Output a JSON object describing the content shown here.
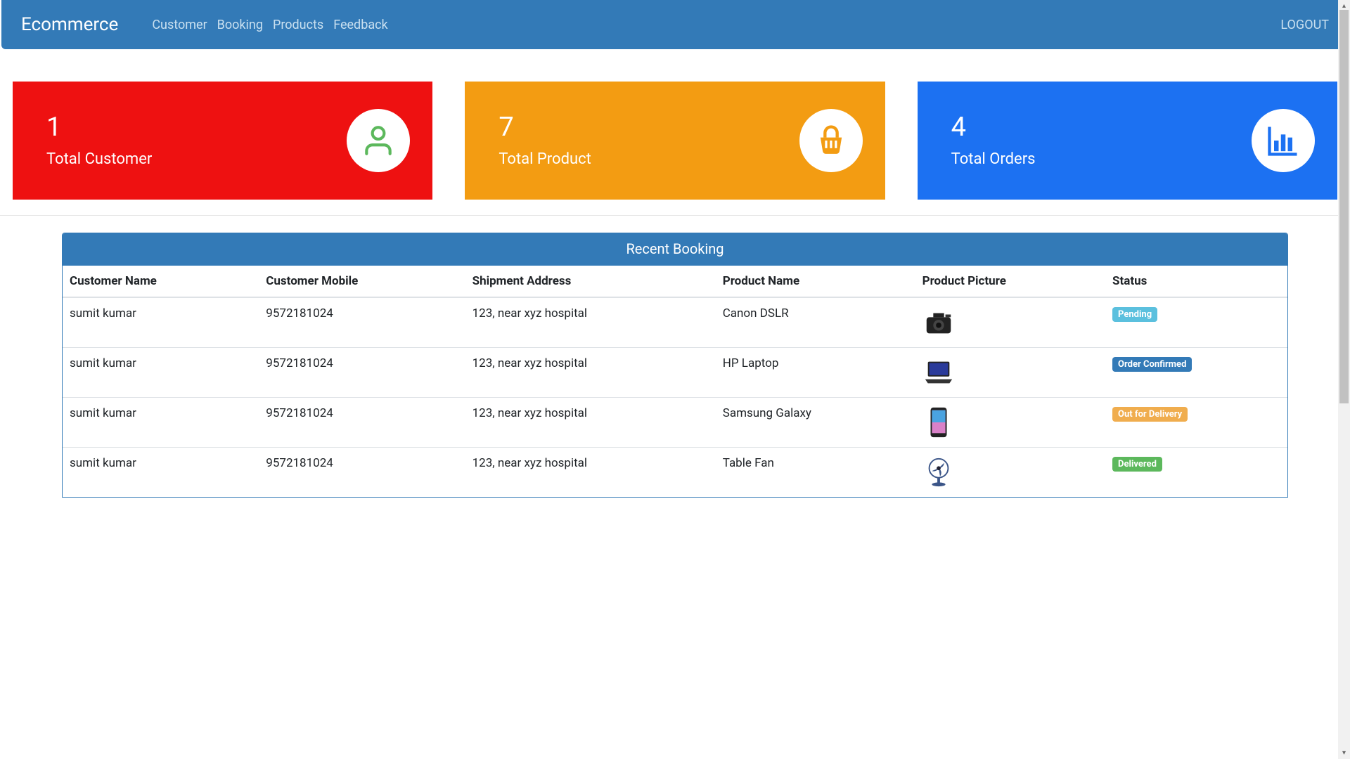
{
  "navbar": {
    "brand": "Ecommerce",
    "links": [
      "Customer",
      "Booking",
      "Products",
      "Feedback"
    ],
    "logout": "LOGOUT"
  },
  "stats": [
    {
      "value": "1",
      "label": "Total Customer",
      "color": "red",
      "icon": "user"
    },
    {
      "value": "7",
      "label": "Total Product",
      "color": "orange",
      "icon": "basket"
    },
    {
      "value": "4",
      "label": "Total Orders",
      "color": "blue",
      "icon": "chart"
    }
  ],
  "panel": {
    "title": "Recent Booking",
    "columns": [
      "Customer Name",
      "Customer Mobile",
      "Shipment Address",
      "Product Name",
      "Product Picture",
      "Status"
    ]
  },
  "rows": [
    {
      "name": "sumit kumar",
      "mobile": "9572181024",
      "address": "123, near xyz hospital",
      "product": "Canon DSLR",
      "pic": "camera",
      "status": "Pending",
      "status_color": "info"
    },
    {
      "name": "sumit kumar",
      "mobile": "9572181024",
      "address": "123, near xyz hospital",
      "product": "HP Laptop",
      "pic": "laptop",
      "status": "Order Confirmed",
      "status_color": "primary"
    },
    {
      "name": "sumit kumar",
      "mobile": "9572181024",
      "address": "123, near xyz hospital",
      "product": "Samsung Galaxy",
      "pic": "phone",
      "status": "Out for Delivery",
      "status_color": "warning"
    },
    {
      "name": "sumit kumar",
      "mobile": "9572181024",
      "address": "123, near xyz hospital",
      "product": "Table Fan",
      "pic": "fan",
      "status": "Delivered",
      "status_color": "success"
    }
  ]
}
